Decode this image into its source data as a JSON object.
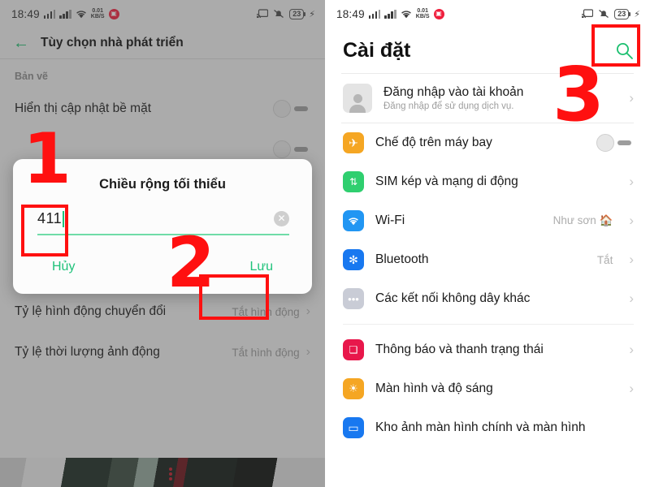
{
  "status_bar": {
    "time": "18:49",
    "data_rate": "0.01",
    "data_unit": "KB/S",
    "battery": "23",
    "icons": [
      "signal-bars-sim1",
      "signal-bars-sim2",
      "wifi-icon",
      "data-rate",
      "app-badge-icon",
      "cast-icon",
      "mute-bell-icon",
      "battery-icon",
      "charging-bolt-icon"
    ]
  },
  "left_panel": {
    "appbar": {
      "title": "Tùy chọn nhà phát triển",
      "back_icon": "back-arrow-icon"
    },
    "section_header": "Bản vẽ",
    "rows": [
      {
        "title": "Hiển thị cập nhật bề mặt",
        "control": "toggle",
        "toggle_on": false
      },
      {
        "title": "Tỷ lệ hình động chuyển đổi",
        "value": "Tắt hình động",
        "control": "chevron"
      },
      {
        "title": "Tỷ lệ thời lượng ảnh động",
        "value": "Tắt hình động",
        "control": "chevron"
      }
    ],
    "dialog": {
      "title": "Chiều rộng tối thiểu",
      "input_value": "411",
      "input_placeholder": "",
      "clear_icon": "clear-circle-icon",
      "cancel_label": "Hủy",
      "save_label": "Lưu"
    }
  },
  "right_panel": {
    "appbar": {
      "title": "Cài đặt",
      "search_icon": "search-icon"
    },
    "account": {
      "title": "Đăng nhập vào tài khoản",
      "subtitle": "Đăng nhập để sử dụng dịch vụ.",
      "avatar_icon": "avatar-icon"
    },
    "rows": [
      {
        "label": "Chế độ trên máy bay",
        "icon": "airplane-icon",
        "color": "#f5a623",
        "control": "toggle",
        "toggle_on": false,
        "value": ""
      },
      {
        "label": "SIM kép và mạng di động",
        "icon": "sim-data-icon",
        "color": "#2fcf6f",
        "control": "chevron",
        "value": ""
      },
      {
        "label": "Wi-Fi",
        "icon": "wifi-icon",
        "color": "#2196f3",
        "control": "chevron",
        "value": "Như sơn 🏠"
      },
      {
        "label": "Bluetooth",
        "icon": "bluetooth-icon",
        "color": "#1878f0",
        "control": "chevron",
        "value": "Tắt"
      },
      {
        "label": "Các kết nối không dây khác",
        "icon": "more-dots-icon",
        "color": "#c9ccd6",
        "control": "chevron",
        "value": ""
      },
      {
        "label": "Thông báo và thanh trạng thái",
        "icon": "notification-icon",
        "color": "#e8174b",
        "control": "chevron",
        "value": ""
      },
      {
        "label": "Màn hình và độ sáng",
        "icon": "brightness-icon",
        "color": "#f5a623",
        "control": "chevron",
        "value": ""
      },
      {
        "label": "Kho ảnh màn hình chính và màn hình",
        "icon": "wallpaper-icon",
        "color": "#1878f0",
        "control": "chevron",
        "value": ""
      }
    ]
  },
  "annotations": {
    "step_1": "1",
    "step_2": "2",
    "step_3": "3",
    "highlight_color": "#ff1010"
  }
}
